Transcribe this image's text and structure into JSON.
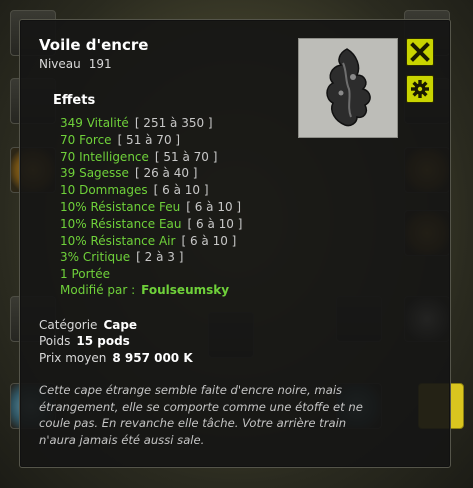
{
  "item": {
    "name": "Voile d'encre",
    "level_label": "Niveau",
    "level": "191",
    "effects_title": "Effets",
    "effects": [
      {
        "text": "349 Vitalité",
        "range": "[ 251 à 350 ]"
      },
      {
        "text": "70 Force",
        "range": "[ 51 à 70 ]"
      },
      {
        "text": "70 Intelligence",
        "range": "[ 51 à 70 ]"
      },
      {
        "text": "39 Sagesse",
        "range": "[ 26 à 40 ]"
      },
      {
        "text": "10 Dommages",
        "range": "[ 6 à 10 ]"
      },
      {
        "text": "10% Résistance Feu",
        "range": "[ 6 à 10 ]"
      },
      {
        "text": "10% Résistance Eau",
        "range": "[ 6 à 10 ]"
      },
      {
        "text": "10% Résistance Air",
        "range": "[ 6 à 10 ]"
      },
      {
        "text": "3% Critique",
        "range": "[ 2 à 3 ]"
      },
      {
        "text": "1 Portée",
        "range": ""
      }
    ],
    "modified_label": "Modifié par :",
    "modified_by": "Foulseumsky",
    "category_label": "Catégorie",
    "category": "Cape",
    "weight_label": "Poids",
    "weight": "15 pods",
    "price_label": "Prix moyen",
    "price": "8 957 000 K",
    "description": "Cette cape étrange semble faite d'encre noire, mais étrangement, elle se comporte comme une étoffe et ne coule pas. En revanche elle tâche. Votre arrière train n'aura jamais été aussi sale."
  },
  "icons": {
    "item": "ink-cape-icon",
    "close": "close-icon",
    "settings": "gear-icon"
  },
  "colors": {
    "effect_green": "#6fd13a",
    "button_yellow": "#c9d400",
    "panel_bg": "#161614"
  }
}
